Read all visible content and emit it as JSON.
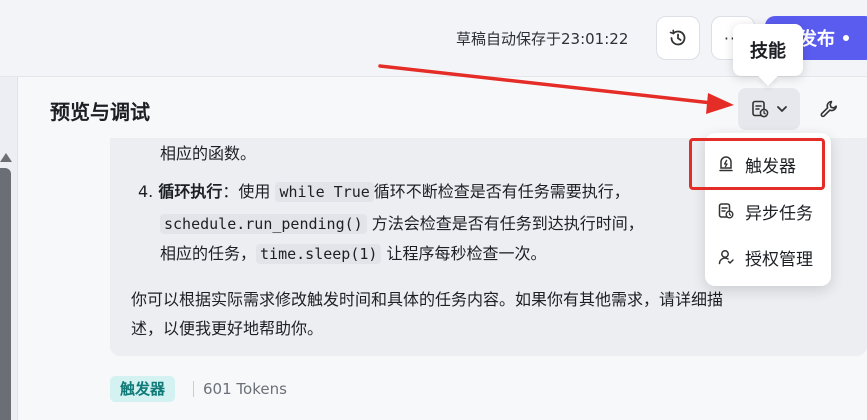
{
  "header": {
    "autosave_text": "草稿自动保存于23:01:22",
    "more_label": "···",
    "publish_label": "发布",
    "tooltip_label": "技能"
  },
  "preview": {
    "title": "预览与调试"
  },
  "message": {
    "line1": "相应的函数。",
    "step4_number": "4.",
    "step4_title": "循环执行",
    "step4_colon": "：使用",
    "code_while": "while True",
    "step4_rest": "循环不断检查是否有任务需要执行，",
    "code_run_pending": "schedule.run_pending()",
    "line3_rest": "方法会检查是否有任务到达执行时间，",
    "line4_start": "相应的任务，",
    "code_sleep": "time.sleep(1)",
    "line4_rest": "让程序每秒检查一次。",
    "para_line1": "你可以根据实际需求修改触发时间和具体的任务内容。如果你有其他需求，请详细描",
    "para_line2": "述，以便我更好地帮助你。"
  },
  "footer": {
    "tag": "触发器",
    "tokens": "601 Tokens"
  },
  "dropdown": {
    "items": [
      {
        "label": "触发器",
        "icon": "trigger-icon"
      },
      {
        "label": "异步任务",
        "icon": "async-task-icon"
      },
      {
        "label": "授权管理",
        "icon": "auth-manage-icon"
      }
    ]
  },
  "colors": {
    "primary": "#5a5cf0",
    "annotation": "#e52d27",
    "tag_bg": "#d3f2f1",
    "tag_text": "#0f7a78"
  }
}
